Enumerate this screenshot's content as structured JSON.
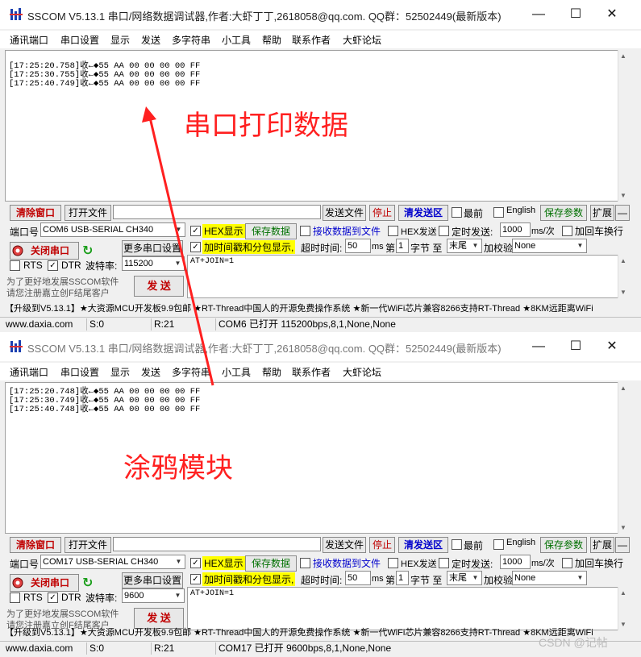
{
  "windows": [
    {
      "title": "SSCOM V5.13.1 串口/网络数据调试器,作者:大虾丁丁,2618058@qq.com. QQ群：52502449(最新版本)",
      "menu": [
        "通讯端口",
        "串口设置",
        "显示",
        "发送",
        "多字符串",
        "小工具",
        "帮助",
        "联系作者",
        "大虾论坛"
      ],
      "log_lines": [
        "[17:25:20.758]收←◆55 AA 00 00 00 00 FF",
        "[17:25:30.755]收←◆55 AA 00 00 00 00 FF",
        "[17:25:40.749]收←◆55 AA 00 00 00 00 FF"
      ],
      "toolbar": {
        "clear_label": "清除窗口",
        "open_file_label": "打开文件",
        "send_file_label": "发送文件",
        "stop_label": "停止",
        "clear_send_label": "清发送区",
        "top_label": "最前",
        "english_label": "English",
        "save_params_label": "保存参数",
        "expand_label": "扩展",
        "collapse_label": "—"
      },
      "port": {
        "port_label": "端口号",
        "port_value": "COM6 USB-SERIAL CH340",
        "close_port_label": "关闭串口",
        "more_settings_label": "更多串口设置",
        "rts_label": "RTS",
        "dtr_label": "DTR",
        "baud_label": "波特率:",
        "baud_value": "115200",
        "promo_note_1": "为了更好地发展SSCOM软件",
        "promo_note_2": "请您注册嘉立创F结尾客户",
        "send_label": "发 送"
      },
      "options": {
        "hex_display": "HEX显示",
        "save_data": "保存数据",
        "recv_to_file": "接收数据到文件",
        "hex_send": "HEX发送",
        "timed_send": "定时发送:",
        "timed_value": "1000",
        "timed_unit": "ms/次",
        "add_crlf": "加回车换行",
        "timestamp": "加时间戳和分包显示,",
        "timeout_label": "超时时间:",
        "timeout_value": "50",
        "ms": "ms",
        "nth_label": "第",
        "nth_value": "1",
        "byte_to": "字节 至",
        "end_value": "末尾",
        "checksum_label": "加校验",
        "checksum_value": "None"
      },
      "send_text": "AT+JOIN=1",
      "promo": "【升级到V5.13.1】★大资源MCU开发板9.9包邮 ★RT-Thread中国人的开源免费操作系统 ★新一代WiFi芯片兼容8266支持RT-Thread ★8KM远距离WiFi",
      "status": {
        "site": "www.daxia.com",
        "s_count": "S:0",
        "r_count": "R:21",
        "port_status": "COM6 已打开  115200bps,8,1,None,None"
      }
    },
    {
      "title": "SSCOM V5.13.1 串口/网络数据调试器,作者:大虾丁丁,2618058@qq.com. QQ群：52502449(最新版本)",
      "menu": [
        "通讯端口",
        "串口设置",
        "显示",
        "发送",
        "多字符串",
        "小工具",
        "帮助",
        "联系作者",
        "大虾论坛"
      ],
      "log_lines": [
        "[17:25:20.748]收←◆55 AA 00 00 00 00 FF",
        "[17:25:30.749]收←◆55 AA 00 00 00 00 FF",
        "[17:25:40.748]收←◆55 AA 00 00 00 00 FF"
      ],
      "toolbar": {
        "clear_label": "清除窗口",
        "open_file_label": "打开文件",
        "send_file_label": "发送文件",
        "stop_label": "停止",
        "clear_send_label": "清发送区",
        "top_label": "最前",
        "english_label": "English",
        "save_params_label": "保存参数",
        "expand_label": "扩展",
        "collapse_label": "—"
      },
      "port": {
        "port_label": "端口号",
        "port_value": "COM17 USB-SERIAL CH340",
        "close_port_label": "关闭串口",
        "more_settings_label": "更多串口设置",
        "rts_label": "RTS",
        "dtr_label": "DTR",
        "baud_label": "波特率:",
        "baud_value": "9600",
        "promo_note_1": "为了更好地发展SSCOM软件",
        "promo_note_2": "请您注册嘉立创F结尾客户",
        "send_label": "发 送"
      },
      "options": {
        "hex_display": "HEX显示",
        "save_data": "保存数据",
        "recv_to_file": "接收数据到文件",
        "hex_send": "HEX发送",
        "timed_send": "定时发送:",
        "timed_value": "1000",
        "timed_unit": "ms/次",
        "add_crlf": "加回车换行",
        "timestamp": "加时间戳和分包显示,",
        "timeout_label": "超时时间:",
        "timeout_value": "50",
        "ms": "ms",
        "nth_label": "第",
        "nth_value": "1",
        "byte_to": "字节 至",
        "end_value": "末尾",
        "checksum_label": "加校验",
        "checksum_value": "None"
      },
      "send_text": "AT+JOIN=1",
      "promo": "【升级到V5.13.1】★大资源MCU开发板9.9包邮 ★RT-Thread中国人的开源免费操作系统 ★新一代WiFi芯片兼容8266支持RT-Thread ★8KM远距离WiFi",
      "status": {
        "site": "www.daxia.com",
        "s_count": "S:0",
        "r_count": "R:21",
        "port_status": "COM17 已打开  9600bps,8,1,None,None"
      }
    }
  ],
  "annotations": {
    "top": "串口打印数据",
    "bottom": "涂鸦模块",
    "color": "#ff2020"
  },
  "watermark": "CSDN @记帖"
}
